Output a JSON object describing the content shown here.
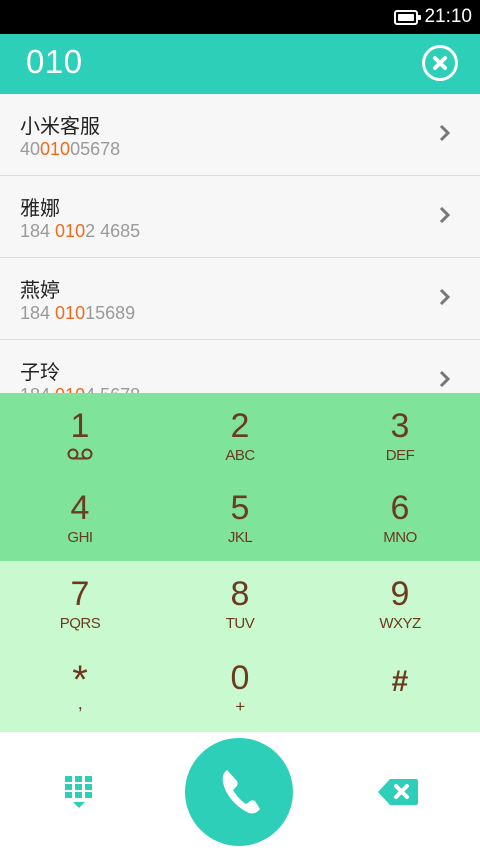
{
  "status_bar": {
    "time": "21:10"
  },
  "header": {
    "dialed_number": "010"
  },
  "contacts": [
    {
      "name": "小米客服",
      "number_prefix": "40",
      "number_match": "010",
      "number_suffix": "05678"
    },
    {
      "name": "雅娜",
      "number_prefix": "184 ",
      "number_match": "010",
      "number_suffix": "2 4685"
    },
    {
      "name": "燕婷",
      "number_prefix": "184 ",
      "number_match": "010",
      "number_suffix": "15689"
    },
    {
      "name": "子玲",
      "number_prefix": "184 ",
      "number_match": "010",
      "number_suffix": "4 5678"
    }
  ],
  "keypad": {
    "keys": [
      {
        "digit": "1",
        "letters": ""
      },
      {
        "digit": "2",
        "letters": "ABC"
      },
      {
        "digit": "3",
        "letters": "DEF"
      },
      {
        "digit": "4",
        "letters": "GHI"
      },
      {
        "digit": "5",
        "letters": "JKL"
      },
      {
        "digit": "6",
        "letters": "MNO"
      },
      {
        "digit": "7",
        "letters": "PQRS"
      },
      {
        "digit": "8",
        "letters": "TUV"
      },
      {
        "digit": "9",
        "letters": "WXYZ"
      },
      {
        "digit": "*",
        "letters": ","
      },
      {
        "digit": "0",
        "letters": "+"
      },
      {
        "digit": "#",
        "letters": ""
      }
    ]
  },
  "colors": {
    "accent": "#2ecfb8",
    "match_highlight": "#f06a1c",
    "keypad_top": "#7fe39a",
    "keypad_bottom": "#c9f9ce",
    "key_text": "#6b3a1f"
  },
  "icons": {
    "clear": "close-circle-icon",
    "chevron": "chevron-right-icon",
    "voicemail": "voicemail-icon",
    "dialpad": "dialpad-icon",
    "call": "phone-icon",
    "backspace": "backspace-icon"
  }
}
